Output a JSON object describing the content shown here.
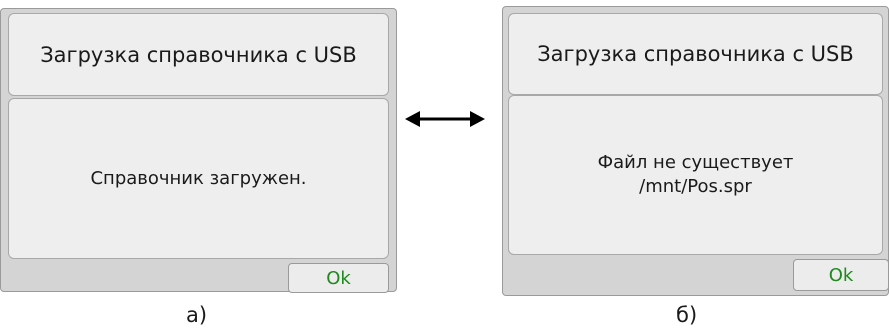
{
  "dialog_a": {
    "title": "Загрузка справочника с USB",
    "message_lines": [
      "Справочник загружен."
    ],
    "ok_label": "Ok"
  },
  "dialog_b": {
    "title": "Загрузка справочника с USB",
    "message_lines": [
      "Файл не существует",
      "/mnt/Pos.spr"
    ],
    "ok_label": "Ok"
  },
  "captions": {
    "a": "а)",
    "b": "б)"
  },
  "icons": {
    "arrow": "double-headed-arrow-icon"
  },
  "colors": {
    "ok_text": "#1e8a1e",
    "dialog_background": "#d4d4d4",
    "panel_background": "#eeeeee"
  }
}
